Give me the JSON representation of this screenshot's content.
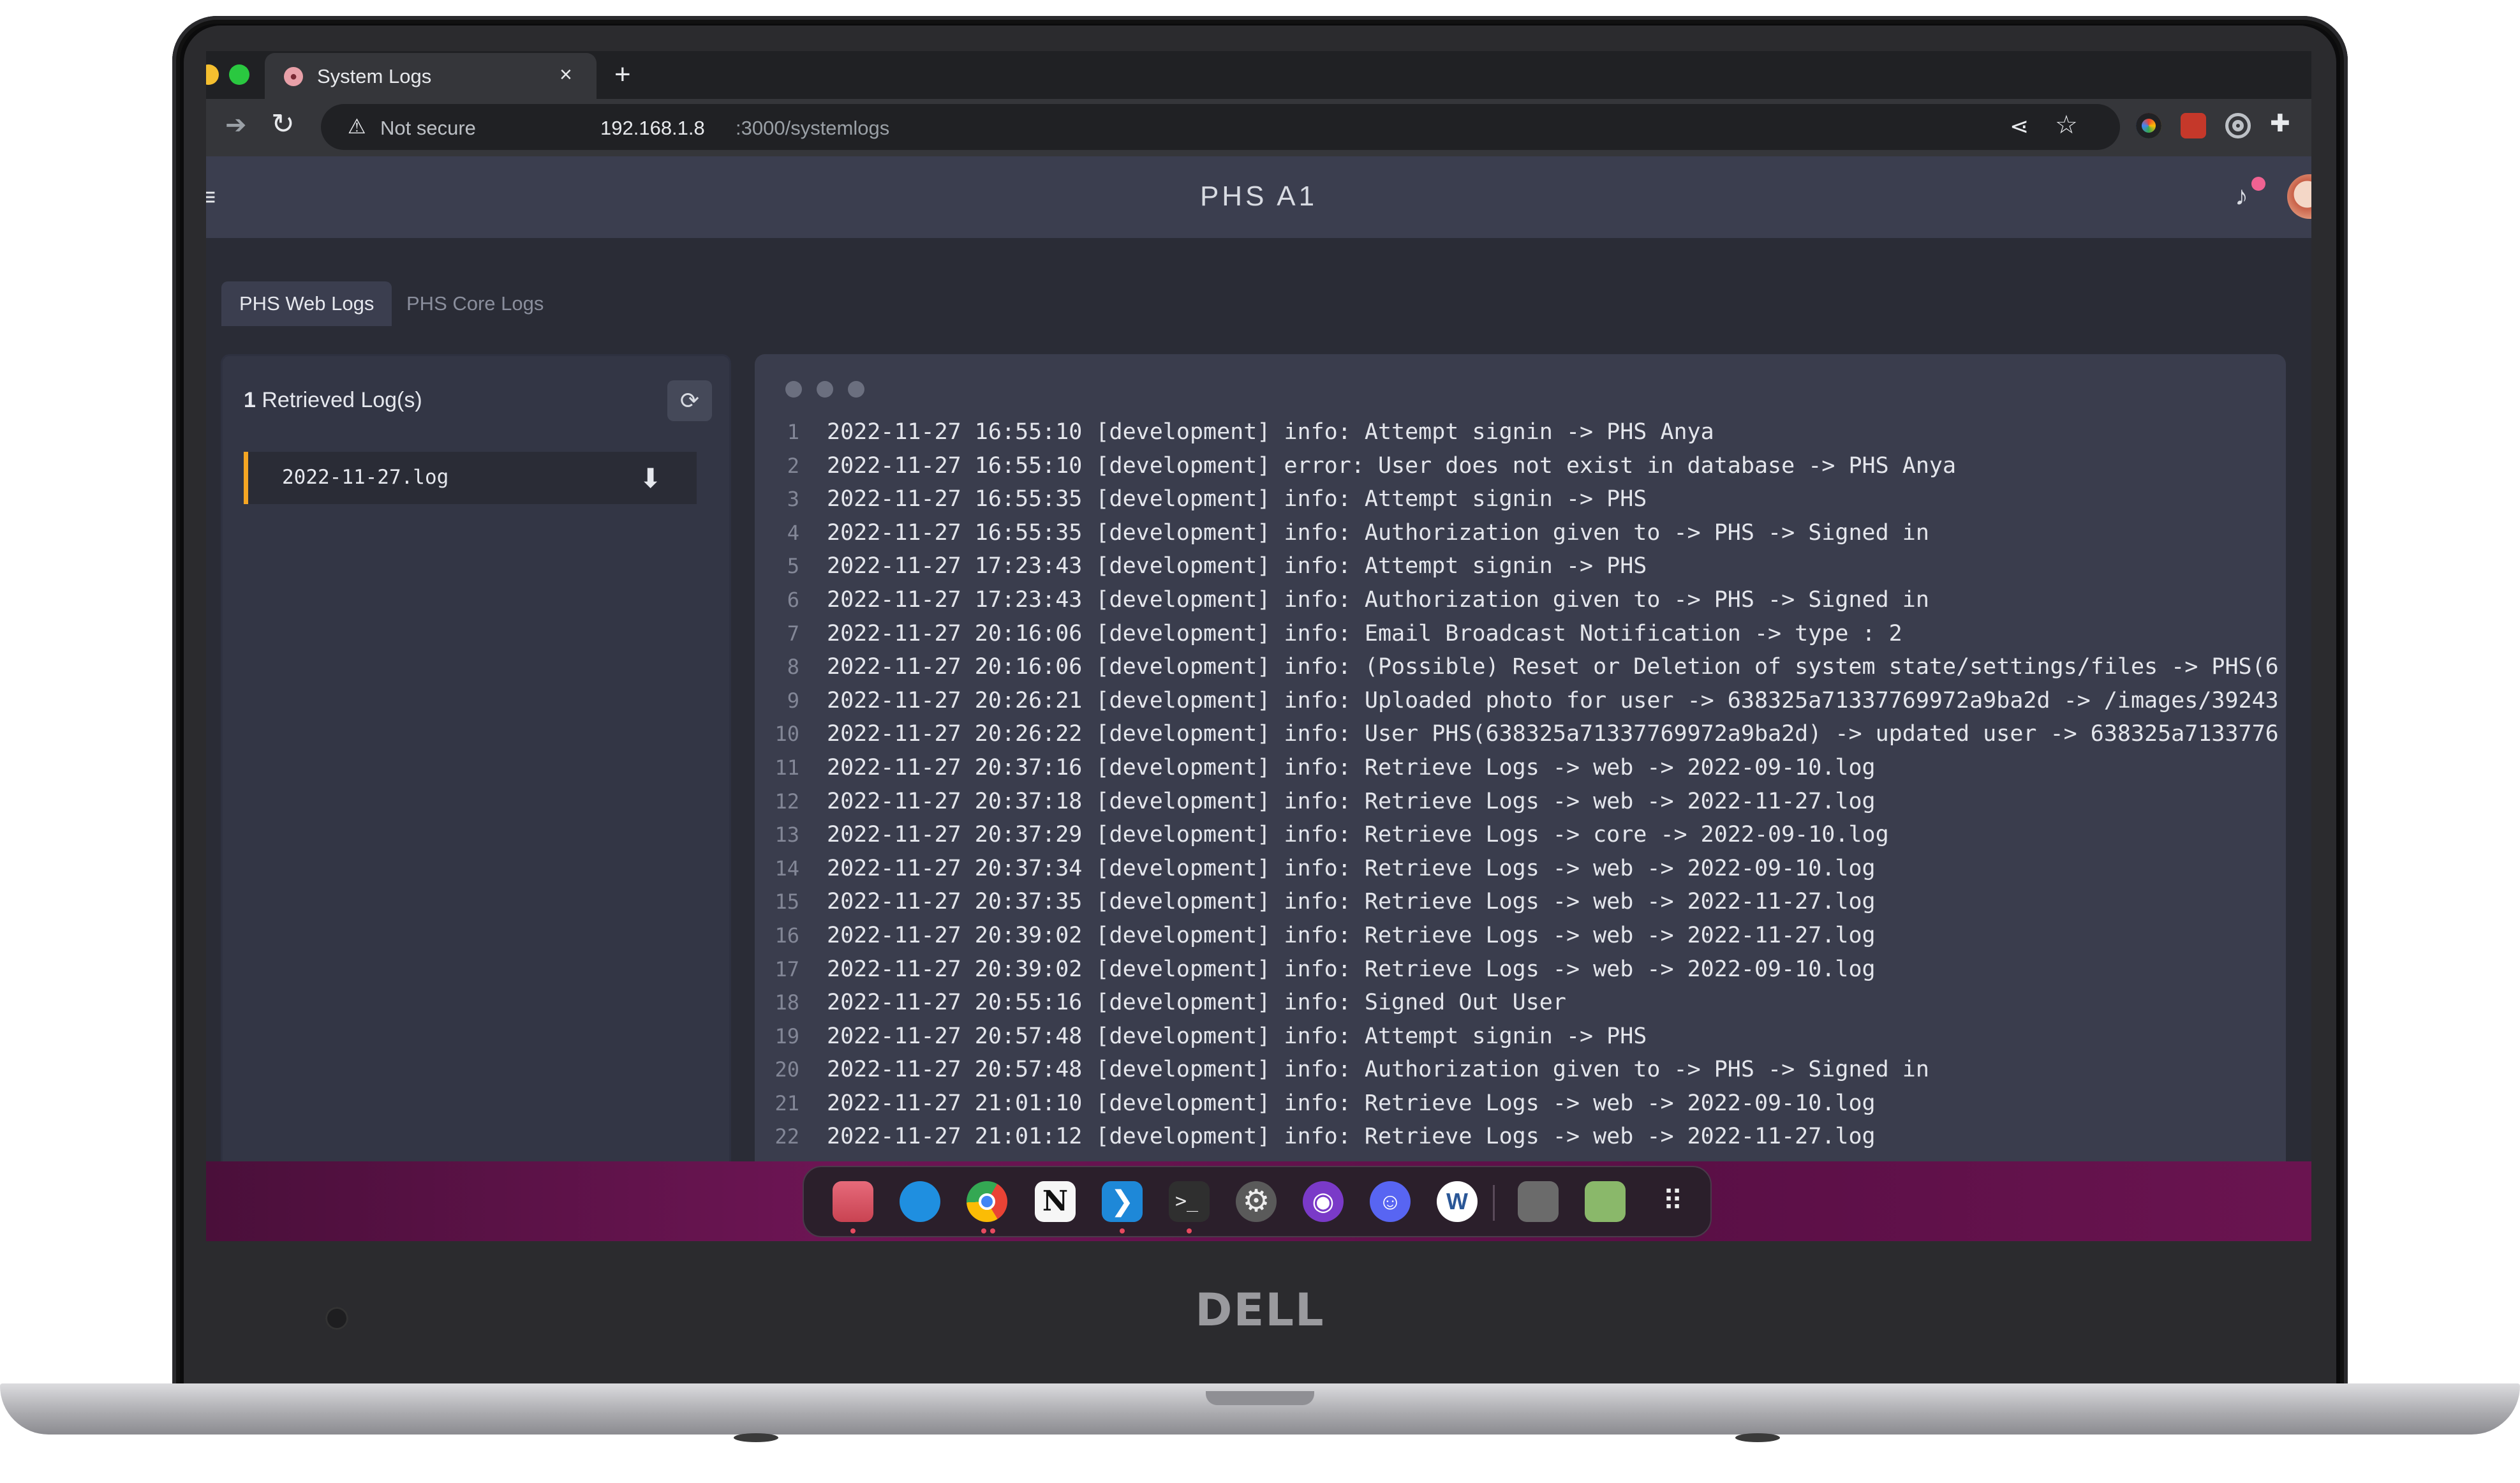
{
  "browser": {
    "tab_title": "System Logs",
    "tab_close": "×",
    "new_tab": "+",
    "not_secure_label": "Not secure",
    "url_host": "192.168.1.8",
    "url_path": ":3000/systemlogs",
    "icons": [
      "favicon-pig-icon",
      "forward-arrow-icon",
      "reload-icon",
      "warning-icon",
      "share-icon",
      "star-icon",
      "color-picker-icon",
      "extension-red-icon",
      "target-icon",
      "puzzle-icon",
      "reading-list-icon",
      "side-panel-icon",
      "profile-avatar"
    ]
  },
  "app": {
    "title": "PHS A1",
    "menu_icon": "≡",
    "bell_icon": "🔔",
    "tabs": [
      {
        "label": "PHS Web Logs",
        "active": true
      },
      {
        "label": "PHS Core Logs",
        "active": false
      }
    ],
    "file_panel": {
      "count_number": "1",
      "count_suffix": " Retrieved Log(s)",
      "refresh_icon": "⟳",
      "files": [
        {
          "name": "2022-11-27.log",
          "download_icon": "⬇"
        }
      ]
    },
    "log_viewer": {
      "lines": [
        {
          "n": "1",
          "text": "2022-11-27 16:55:10 [development] info: Attempt signin -> PHS Anya"
        },
        {
          "n": "2",
          "text": "2022-11-27 16:55:10 [development] error: User does not exist in database -> PHS Anya"
        },
        {
          "n": "3",
          "text": "2022-11-27 16:55:35 [development] info: Attempt signin -> PHS"
        },
        {
          "n": "4",
          "text": "2022-11-27 16:55:35 [development] info: Authorization given to -> PHS -> Signed in"
        },
        {
          "n": "5",
          "text": "2022-11-27 17:23:43 [development] info: Attempt signin -> PHS"
        },
        {
          "n": "6",
          "text": "2022-11-27 17:23:43 [development] info: Authorization given to -> PHS -> Signed in"
        },
        {
          "n": "7",
          "text": "2022-11-27 20:16:06 [development] info: Email Broadcast Notification ->  type : 2"
        },
        {
          "n": "8",
          "text": "2022-11-27 20:16:06 [development] info: (Possible) Reset or Deletion of system state/settings/files -> PHS(6"
        },
        {
          "n": "9",
          "text": "2022-11-27 20:26:21 [development] info: Uploaded photo for user -> 638325a71337769972a9ba2d -> /images/39243"
        },
        {
          "n": "10",
          "text": "2022-11-27 20:26:22 [development] info: User PHS(638325a71337769972a9ba2d) -> updated user -> 638325a7133776"
        },
        {
          "n": "11",
          "text": "2022-11-27 20:37:16 [development] info: Retrieve Logs -> web -> 2022-09-10.log"
        },
        {
          "n": "12",
          "text": "2022-11-27 20:37:18 [development] info: Retrieve Logs -> web -> 2022-11-27.log"
        },
        {
          "n": "13",
          "text": "2022-11-27 20:37:29 [development] info: Retrieve Logs -> core -> 2022-09-10.log"
        },
        {
          "n": "14",
          "text": "2022-11-27 20:37:34 [development] info: Retrieve Logs -> web -> 2022-09-10.log"
        },
        {
          "n": "15",
          "text": "2022-11-27 20:37:35 [development] info: Retrieve Logs -> web -> 2022-11-27.log"
        },
        {
          "n": "16",
          "text": "2022-11-27 20:39:02 [development] info: Retrieve Logs -> web -> 2022-11-27.log"
        },
        {
          "n": "17",
          "text": "2022-11-27 20:39:02 [development] info: Retrieve Logs -> web -> 2022-09-10.log"
        },
        {
          "n": "18",
          "text": "2022-11-27 20:55:16 [development] info: Signed Out User"
        },
        {
          "n": "19",
          "text": "2022-11-27 20:57:48 [development] info: Attempt signin -> PHS"
        },
        {
          "n": "20",
          "text": "2022-11-27 20:57:48 [development] info: Authorization given to -> PHS -> Signed in"
        },
        {
          "n": "21",
          "text": "2022-11-27 21:01:10 [development] info: Retrieve Logs -> web -> 2022-09-10.log"
        },
        {
          "n": "22",
          "text": "2022-11-27 21:01:12 [development] info: Retrieve Logs -> web -> 2022-11-27.log"
        }
      ]
    }
  },
  "dock": {
    "notion_glyph": "N",
    "vscode_glyph": "❯",
    "terminal_glyph": ">_",
    "settings_glyph": "⚙",
    "apps_glyph": "⠿",
    "items": [
      "files-icon",
      "thunderbird-icon",
      "chrome-icon",
      "notion-icon",
      "vscode-icon",
      "terminal-icon",
      "settings-icon",
      "github-desktop-icon",
      "discord-icon",
      "word-icon",
      "disk-icon",
      "trash-icon",
      "show-apps-icon"
    ]
  },
  "device": {
    "brand": "DELL"
  },
  "colors": {
    "accent_orange": "#f5a623",
    "header_bg": "#3b3e4f",
    "viewer_bg": "#3a3d4d",
    "dock_magenta": "#6d1554",
    "notification_pink": "#f06292"
  }
}
